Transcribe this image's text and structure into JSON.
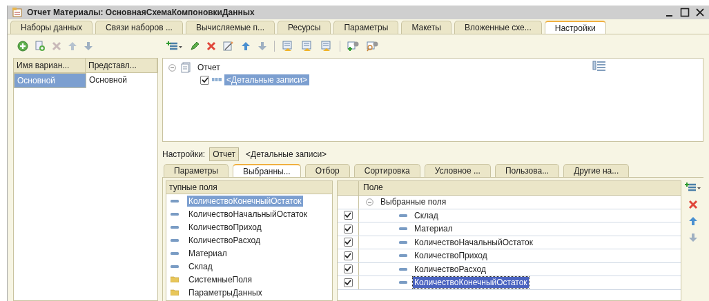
{
  "window": {
    "title": "Отчет Материалы: ОсновнаяСхемаКомпоновкиДанных"
  },
  "window_tabs": [
    {
      "label": "Наборы данных",
      "selected": false
    },
    {
      "label": "Связи наборов ...",
      "selected": false
    },
    {
      "label": "Вычисляемые п...",
      "selected": false
    },
    {
      "label": "Ресурсы",
      "selected": false
    },
    {
      "label": "Параметры",
      "selected": false
    },
    {
      "label": "Макеты",
      "selected": false
    },
    {
      "label": "Вложенные схе...",
      "selected": false
    },
    {
      "label": "Настройки",
      "selected": true
    }
  ],
  "variants": {
    "columns": [
      "Имя вариан...",
      "Представл..."
    ],
    "rows": [
      {
        "cells": [
          "Основной",
          "Основной"
        ],
        "selected": true
      }
    ]
  },
  "structure": {
    "label": "Отчет",
    "expanded": true,
    "children": [
      {
        "label": "<Детальные записи>",
        "checked": true,
        "selected": true
      }
    ]
  },
  "settings_bar": {
    "label": "Настройки:",
    "path": [
      {
        "label": "Отчет",
        "selected": true
      },
      {
        "label": "<Детальные записи>",
        "selected": false
      }
    ]
  },
  "settings_tabs": [
    {
      "label": "Параметры",
      "selected": false
    },
    {
      "label": "Выбранны...",
      "selected": true
    },
    {
      "label": "Отбор",
      "selected": false
    },
    {
      "label": "Сортировка",
      "selected": false
    },
    {
      "label": "Условное ...",
      "selected": false
    },
    {
      "label": "Пользова...",
      "selected": false
    },
    {
      "label": "Другие на...",
      "selected": false
    }
  ],
  "available_fields": {
    "header": "тупные поля",
    "items": [
      {
        "label": "КоличествоКонечныйОстаток",
        "kind": "field",
        "selected": true
      },
      {
        "label": "КоличествоНачальныйОстаток",
        "kind": "field",
        "selected": false
      },
      {
        "label": "КоличествоПриход",
        "kind": "field",
        "selected": false
      },
      {
        "label": "КоличествоРасход",
        "kind": "field",
        "selected": false
      },
      {
        "label": "Материал",
        "kind": "field",
        "selected": false
      },
      {
        "label": "Склад",
        "kind": "field",
        "selected": false
      },
      {
        "label": "СистемныеПоля",
        "kind": "folder",
        "selected": false
      },
      {
        "label": "ПараметрыДанных",
        "kind": "folder",
        "selected": false
      }
    ]
  },
  "selected_fields": {
    "header": "Поле",
    "group": {
      "label": "Выбранные поля",
      "expanded": true
    },
    "rows": [
      {
        "label": "Склад",
        "checked": true,
        "selected": false
      },
      {
        "label": "Материал",
        "checked": true,
        "selected": false
      },
      {
        "label": "КоличествоНачальныйОстаток",
        "checked": true,
        "selected": false
      },
      {
        "label": "КоличествоПриход",
        "checked": true,
        "selected": false
      },
      {
        "label": "КоличествоРасход",
        "checked": true,
        "selected": false
      },
      {
        "label": "КоличествоКонечныйОстаток",
        "checked": true,
        "selected": true
      }
    ]
  }
}
